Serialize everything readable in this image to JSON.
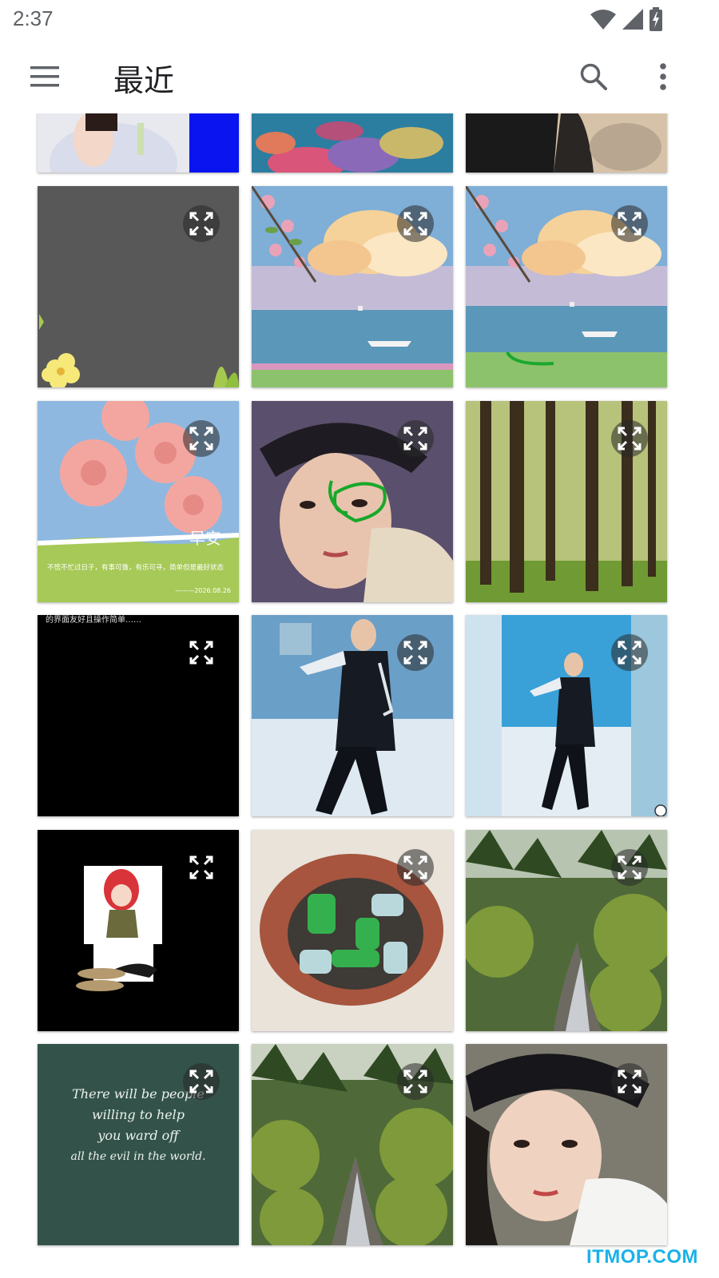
{
  "status_bar": {
    "time": "2:37",
    "icons": [
      "wifi-icon",
      "cellular-signal-icon",
      "battery-charging-icon"
    ]
  },
  "app_bar": {
    "menu_icon": "menu-icon",
    "title": "最近",
    "search_icon": "search-icon",
    "more_icon": "more-vert-icon"
  },
  "grid": {
    "tiles": [
      {
        "kind": "portrait-blue-bg"
      },
      {
        "kind": "coral-reef"
      },
      {
        "kind": "dark-fabric"
      },
      {
        "kind": "gray-flowers",
        "expand_icon": "fullscreen-icon"
      },
      {
        "kind": "sky-sea-blossoms",
        "expand_icon": "fullscreen-icon"
      },
      {
        "kind": "sky-sea-blossoms-annotated",
        "expand_icon": "fullscreen-icon"
      },
      {
        "kind": "gerbera-card",
        "caption": "不慌不忙过日子，有事可做，有乐可寻，简单但是最好状态",
        "date": "———2026.08.26",
        "stamp": "早安",
        "expand_icon": "fullscreen-icon"
      },
      {
        "kind": "portrait-annotated",
        "expand_icon": "fullscreen-icon"
      },
      {
        "kind": "forest",
        "expand_icon": "fullscreen-icon"
      },
      {
        "kind": "black-screen",
        "top_text": "的界面友好且操作简单……",
        "expand_icon": "fullscreen-icon"
      },
      {
        "kind": "snow-skier",
        "expand_icon": "fullscreen-icon"
      },
      {
        "kind": "snow-skier-edited",
        "expand_icon": "fullscreen-icon"
      },
      {
        "kind": "anime-sticker",
        "expand_icon": "fullscreen-icon"
      },
      {
        "kind": "bottles-bag",
        "expand_icon": "fullscreen-icon"
      },
      {
        "kind": "river-forest",
        "expand_icon": "fullscreen-icon"
      },
      {
        "kind": "green-quote",
        "quote_lines": [
          "There will be people",
          "willing to help",
          "you ward off",
          "all the evil in the world."
        ],
        "expand_icon": "fullscreen-icon"
      },
      {
        "kind": "river-forest",
        "expand_icon": "fullscreen-icon"
      },
      {
        "kind": "portrait-beret",
        "expand_icon": "fullscreen-icon"
      }
    ]
  },
  "watermark": "ITMOP.COM"
}
